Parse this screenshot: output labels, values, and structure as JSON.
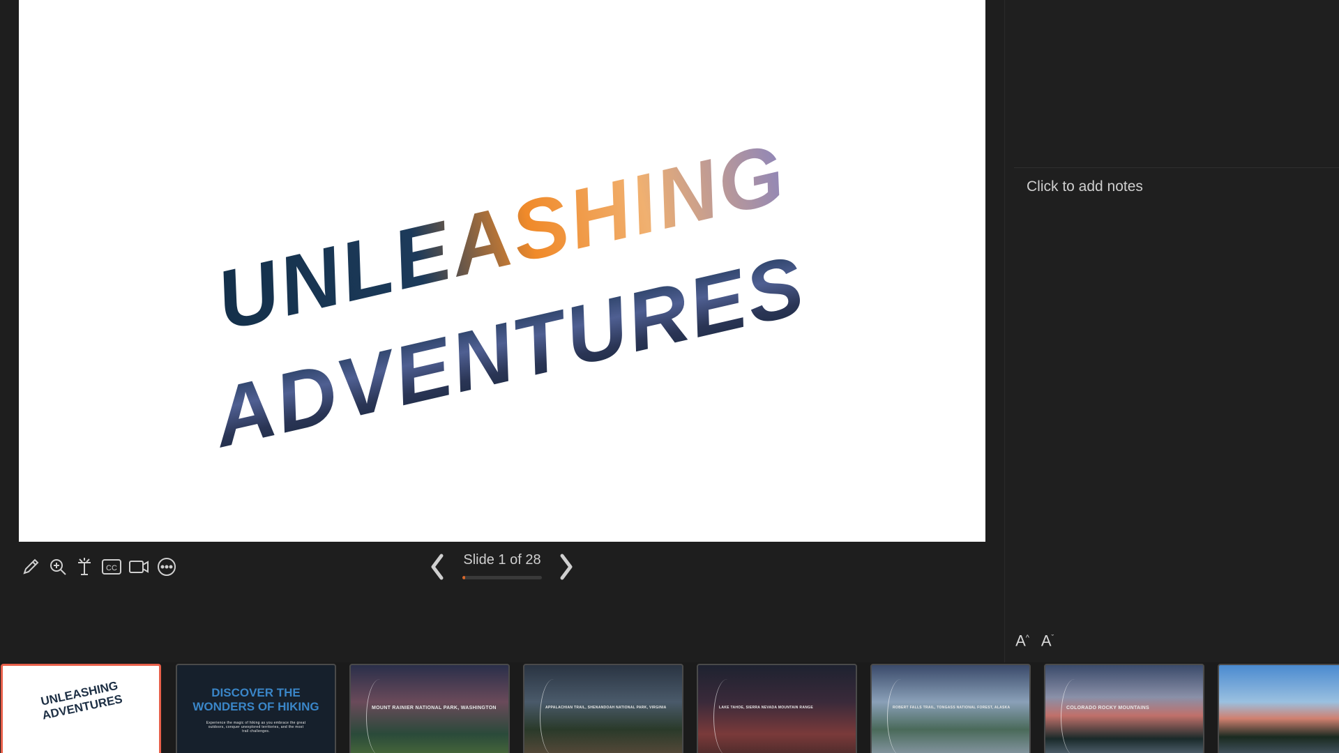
{
  "slide": {
    "title_line1": "UNLEASHING",
    "title_line2": "ADVENTURES"
  },
  "notes": {
    "placeholder": "Click to add notes",
    "increase_font_label": "A",
    "decrease_font_label": "A"
  },
  "toolbar": {
    "tools": [
      "pen-icon",
      "zoom-icon",
      "laser-pointer-icon",
      "captions-icon",
      "camera-icon",
      "more-options-icon"
    ],
    "captions_label": "CC"
  },
  "navigation": {
    "counter": "Slide 1 of 28",
    "current": 1,
    "total": 28,
    "progress": 0.036
  },
  "colors": {
    "accent": "#d8672a",
    "active_thumb_border": "#e8604a",
    "background": "#1e1e1e"
  },
  "thumbnails": [
    {
      "title": "UNLEASHING ADVENTURES"
    },
    {
      "title": "DISCOVER THE WONDERS OF HIKING",
      "sub": "Experience the magic of hiking as you embrace the great outdoors, conquer unexplored territories, and the most trail challenges."
    },
    {
      "sub": "MOUNT RAINIER NATIONAL PARK, WASHINGTON"
    },
    {
      "sub": "APPALACHIAN TRAIL, SHENANDOAH NATIONAL PARK, VIRGINIA"
    },
    {
      "sub": "LAKE TAHOE, SIERRA NEVADA MOUNTAIN RANGE"
    },
    {
      "sub": "ROBERT FALLS TRAIL, TONGASS NATIONAL FOREST, ALASKA"
    },
    {
      "sub": "COLORADO ROCKY MOUNTAINS"
    },
    {}
  ]
}
